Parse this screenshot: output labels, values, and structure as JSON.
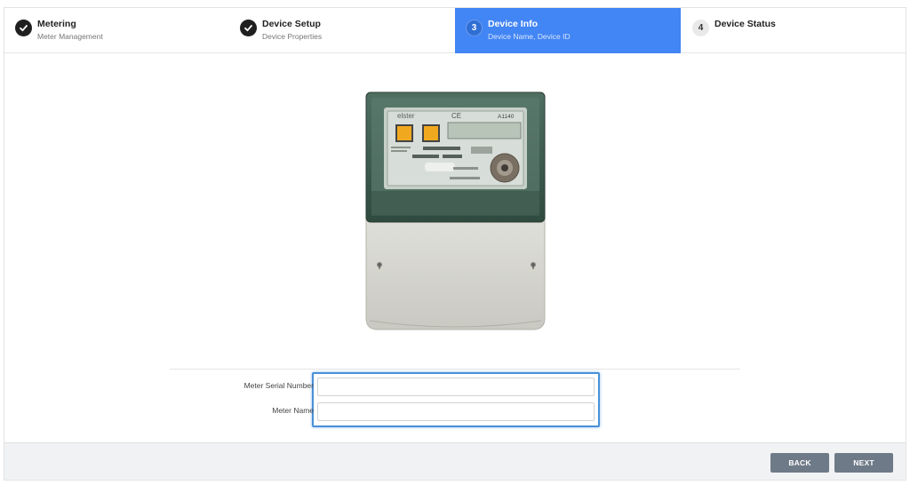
{
  "steps": [
    {
      "title": "Metering",
      "subtitle": "Meter Management",
      "state": "done",
      "number": ""
    },
    {
      "title": "Device Setup",
      "subtitle": "Device Properties",
      "state": "done",
      "number": ""
    },
    {
      "title": "Device Info",
      "subtitle": "Device Name, Device ID",
      "state": "active",
      "number": "3"
    },
    {
      "title": "Device Status",
      "subtitle": "",
      "state": "todo",
      "number": "4"
    }
  ],
  "meter_image": {
    "brand": "elster",
    "model": "A1140",
    "mark": "CE"
  },
  "form": {
    "serial_label": "Meter Serial Number",
    "serial_value": "",
    "name_label": "Meter Name",
    "name_value": ""
  },
  "footer": {
    "back_label": "BACK",
    "next_label": "NEXT"
  },
  "colors": {
    "accent": "#4285f4",
    "button": "#6e7a87",
    "focus": "#4a90d9"
  }
}
